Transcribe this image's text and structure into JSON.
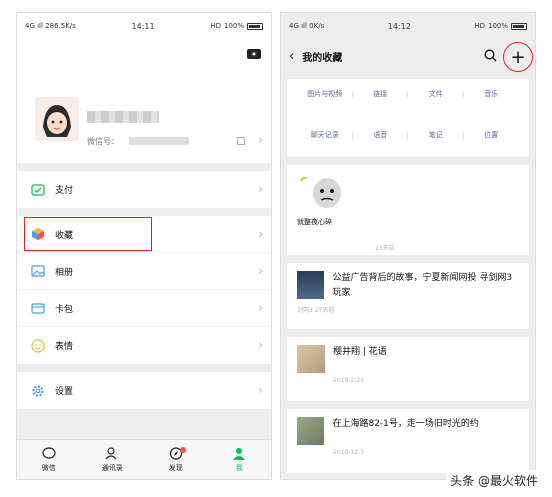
{
  "left_phone": {
    "status": {
      "signal": "4G ıll",
      "speed": "286.5K/s",
      "time": "14:11",
      "right": "HD",
      "battery": "100%"
    },
    "profile": {
      "wechat_id_label": "微信号："
    },
    "menu": {
      "pay": "支付",
      "favorites": "收藏",
      "album": "相册",
      "cards": "卡包",
      "stickers": "表情",
      "settings": "设置"
    },
    "tabs": [
      {
        "label": "微信"
      },
      {
        "label": "通讯录"
      },
      {
        "label": "发现"
      },
      {
        "label": "我"
      }
    ]
  },
  "right_phone": {
    "status": {
      "signal": "4G ıll",
      "speed": "0K/s",
      "time": "14:12",
      "right": "HD",
      "battery": "100%"
    },
    "title": "我的收藏",
    "filters": [
      "图片与视频",
      "链接",
      "文件",
      "音乐",
      "聊天记录",
      "语音",
      "笔记",
      "位置"
    ],
    "items": [
      {
        "text": "就整夜心碎",
        "meta": "13天前"
      },
      {
        "text": "公益广告背后的故事，宁夏新闻网投 寻剑网3玩家",
        "meta": "剑网3  27天前"
      },
      {
        "text": "樱井翔 | 花语",
        "meta": "2019-2-21"
      },
      {
        "text": "在上海路82-1号，走一场旧时光的约",
        "meta": "2018-12-3"
      }
    ]
  },
  "watermark": "头条 @最火软件",
  "colors": {
    "accent_green": "#07c160",
    "highlight_red": "#e02020",
    "link_blue": "#576b95"
  }
}
